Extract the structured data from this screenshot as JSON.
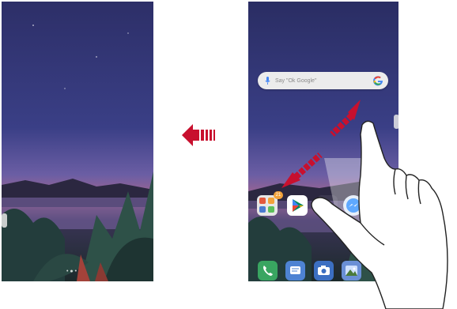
{
  "left_screen": {
    "page_indicator": "• ● •"
  },
  "swipe_left_arrow_icon": "arrow-left-icon",
  "right_screen": {
    "status_left": "",
    "status_right": "",
    "search": {
      "placeholder": "Say \"Ok Google\"",
      "mic_icon": "mic-icon",
      "logo_icon": "google-g-icon"
    },
    "apps": [
      {
        "name": "folder",
        "badge": "21",
        "label": ""
      },
      {
        "name": "play-store",
        "label": ""
      },
      {
        "name": "blank-1",
        "label": ""
      },
      {
        "name": "messenger",
        "label": ""
      }
    ],
    "dock": [
      {
        "name": "phone"
      },
      {
        "name": "messages"
      },
      {
        "name": "camera"
      },
      {
        "name": "gallery"
      }
    ]
  },
  "colors": {
    "arrow": "#c8102e",
    "sky_top": "#2a2f6e",
    "sky_bottom": "#b4627f"
  }
}
